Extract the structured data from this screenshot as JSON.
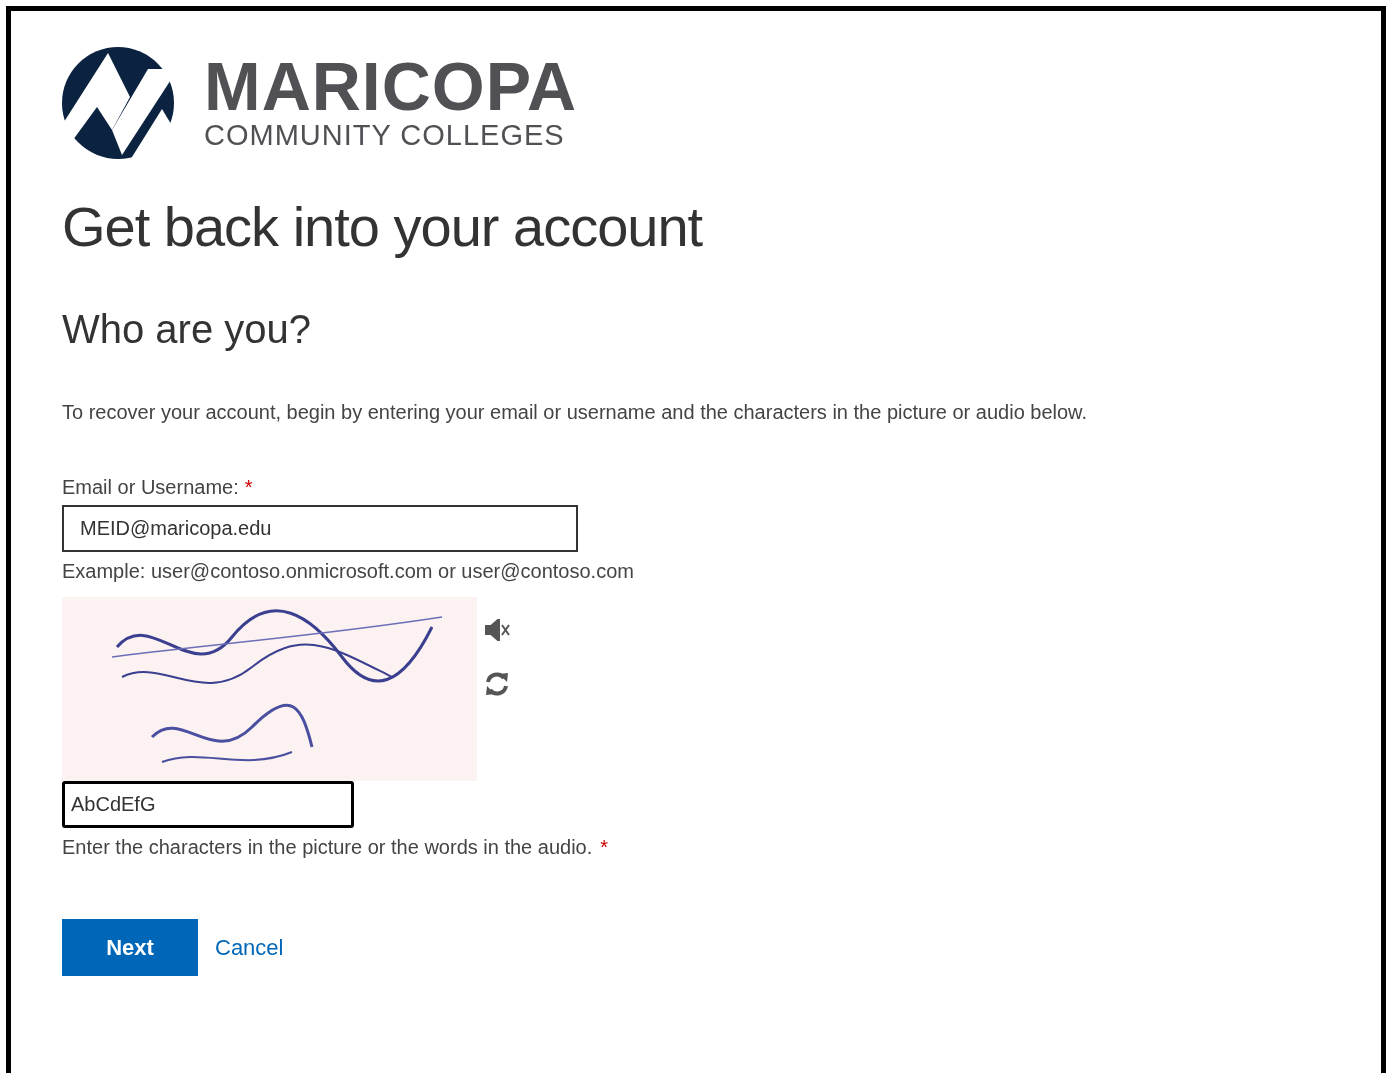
{
  "logo": {
    "name": "MARICOPA",
    "subtitle": "COMMUNITY COLLEGES"
  },
  "title": "Get back into your account",
  "subtitle": "Who are you?",
  "description": "To recover your account, begin by entering your email or username and the characters in the picture or audio below.",
  "email_field": {
    "label": "Email or Username:",
    "required_mark": "*",
    "value": "MEID@maricopa.edu",
    "hint": "Example: user@contoso.onmicrosoft.com or user@contoso.com"
  },
  "captcha": {
    "field": {
      "value": "AbCdEfG",
      "focused": true
    },
    "hint": "Enter the characters in the picture or the words in the audio.",
    "required_mark": "*"
  },
  "buttons": [
    {
      "kind": "primary",
      "label": "Next"
    },
    {
      "kind": "link",
      "label": "Cancel"
    }
  ]
}
